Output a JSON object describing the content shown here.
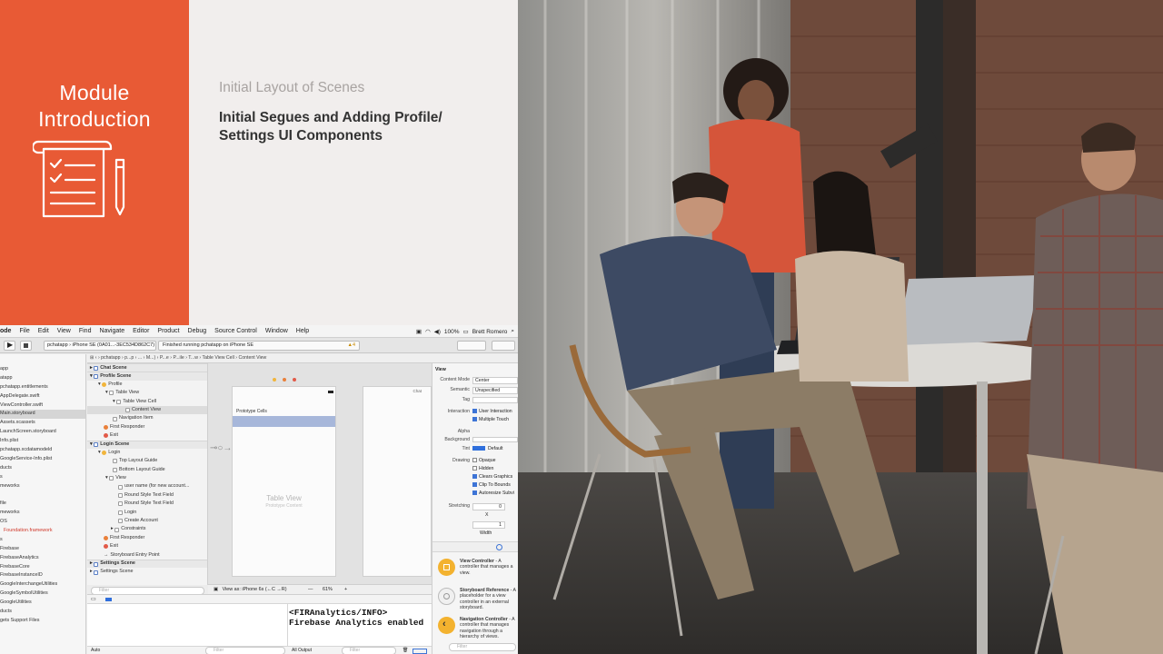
{
  "slide": {
    "module_title_line1": "Module",
    "module_title_line2": "Introduction",
    "topic_previous": "Initial Layout of Scenes",
    "topic_current": "Initial Segues and Adding Profile/ Settings UI Components",
    "colors": {
      "accent": "#e85a35",
      "panel_bg": "#f1eeed",
      "muted_text": "#a8a3a1",
      "title_text": "#333333"
    }
  },
  "xcode": {
    "menu": [
      "ode",
      "File",
      "Edit",
      "View",
      "Find",
      "Navigate",
      "Editor",
      "Product",
      "Debug",
      "Source Control",
      "Window",
      "Help"
    ],
    "status_battery": "100%",
    "status_user": "Brett Romero",
    "scheme_label": "pchatapp",
    "device_label": "iPhone SE (0A01...-3EC534D862C7)",
    "activity_text": "Finished running pchatapp on iPhone SE",
    "warning_count": "4",
    "jump_bar": [
      "pchatapp",
      "p...p",
      "...",
      "M...)",
      "P...e",
      "P...ile",
      "T...w",
      "Table View Cell",
      "Content View"
    ],
    "navigator_items": [
      "app",
      "atapp",
      "pchatapp.entitlements",
      "AppDelegate.swift",
      "ViewController.swift",
      "Main.storyboard",
      "Assets.xcassets",
      "LaunchScreen.storyboard",
      "Info.plist",
      "pchatapp.xcdatamodeld",
      "GoogleService-Info.plist",
      "ducts",
      "s",
      "meworks",
      "",
      "file",
      "meworks",
      "OS",
      "Foundation.framework",
      "s",
      "Firebase",
      "FirebaseAnalytics",
      "FirebaseCore",
      "FirebaseInstanceID",
      "GoogleInterchangeUtilities",
      "GoogleSymbolUtilities",
      "GoogleUtilities",
      "ducts",
      "gets Support Files"
    ],
    "outline": {
      "chat_scene": "Chat Scene",
      "profile_scene": "Profile Scene",
      "profile": "Profile",
      "table_view": "Table View",
      "table_view_cell": "Table View Cell",
      "content_view": "Content View",
      "navigation_item": "Navigation Item",
      "first_responder": "First Responder",
      "exit": "Exit",
      "login_scene": "Login Scene",
      "login": "Login",
      "top_layout_guide": "Top Layout Guide",
      "bottom_layout_guide": "Bottom Layout Guide",
      "view": "View",
      "user_name_field": "user name (for new account...",
      "round_style_1": "Round Style Text Field",
      "round_style_2": "Round Style Text Field",
      "login_button": "Login",
      "create_account": "Create Account",
      "constraints": "Constraints",
      "first_responder_2": "First Responder",
      "exit_2": "Exit",
      "storyboard_entry": "Storyboard Entry Point",
      "settings_scene": "Settings Scene",
      "filter_placeholder": "Filter"
    },
    "canvas": {
      "prototype_cells": "Prototype Cells",
      "table_view_title": "Table View",
      "table_view_subtitle": "Prototype Content",
      "second_scene_title": "Chat",
      "view_as": "View as: iPhone 6s (←C →R)",
      "zoom_level": "61%"
    },
    "inspector": {
      "section": "View",
      "content_mode_label": "Content Mode",
      "content_mode_value": "Center",
      "semantic_label": "Semantic",
      "semantic_value": "Unspecified",
      "tag_label": "Tag",
      "interaction_label": "Interaction",
      "user_interaction": "User Interaction",
      "multiple_touch": "Multiple Touch",
      "alpha_label": "Alpha",
      "background_label": "Background",
      "tint_label": "Tint",
      "tint_value": "Default",
      "drawing_label": "Drawing",
      "opaque": "Opaque",
      "hidden": "Hidden",
      "clears_graphics": "Clears Graphics",
      "clip_to_bounds": "Clip To Bounds",
      "autoresize": "Autoresize Subvi",
      "stretching_label": "Stretching",
      "stretch_value_1": "0",
      "stretch_value_2": "1",
      "x_label": "X",
      "width_label": "Width"
    },
    "library": [
      {
        "title": "View Controller",
        "desc": " - A controller that manages a view.",
        "color": "#f3b22f"
      },
      {
        "title": "Storyboard Reference",
        "desc": " - A placeholder for a view controller in an external storyboard.",
        "color": "#f0f0f0"
      },
      {
        "title": "Navigation Controller",
        "desc": " - A controller that manages navigation through a hierarchy of views.",
        "color": "#f3b22f"
      }
    ],
    "console_lines": [
      "<FIRAnalytics/INFO>",
      "Firebase Analytics enabled"
    ],
    "debug_auto": "Auto",
    "debug_output": "All Output",
    "debug_filter": "Filter"
  }
}
